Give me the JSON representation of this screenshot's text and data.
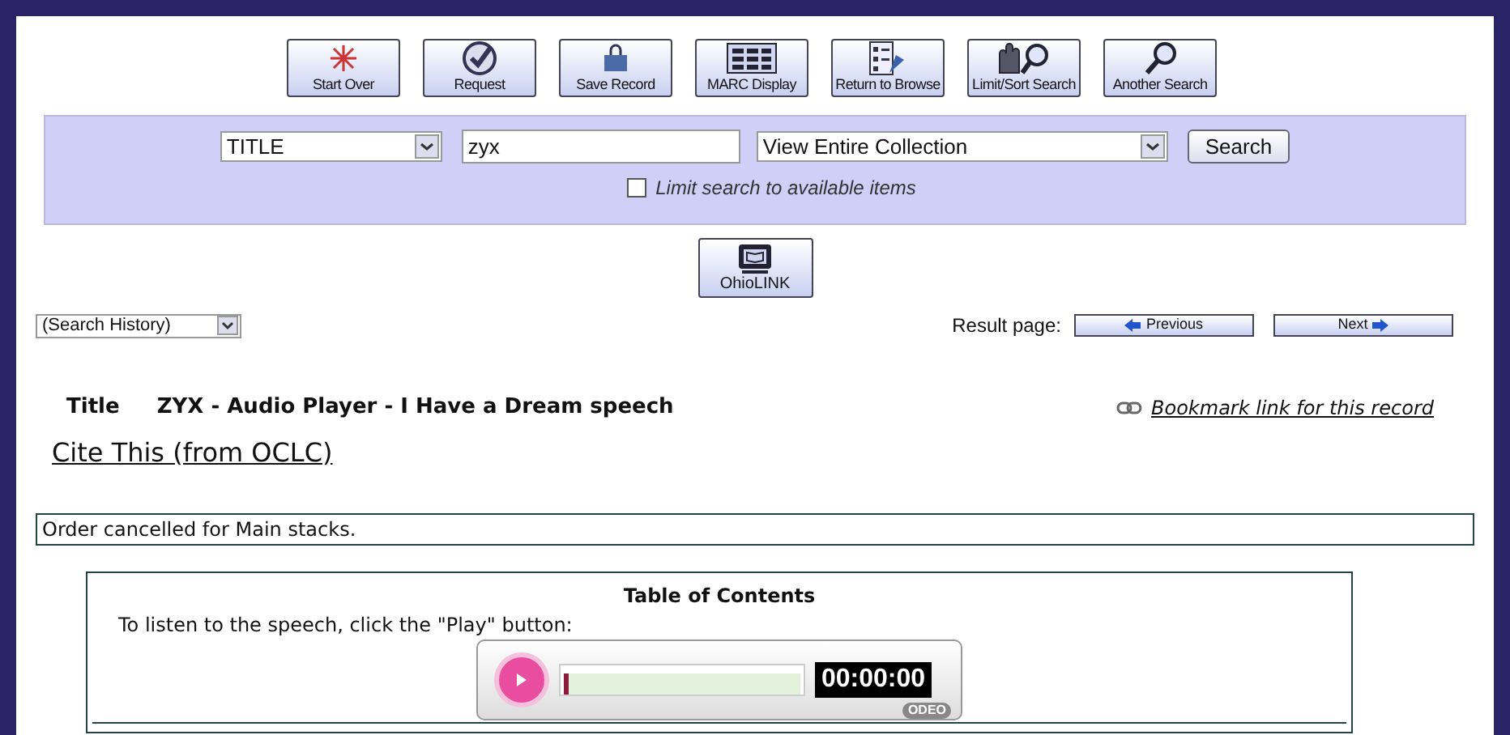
{
  "toolbar_buttons": [
    {
      "label": "Start Over"
    },
    {
      "label": "Request"
    },
    {
      "label": "Save Record"
    },
    {
      "label": "MARC Display"
    },
    {
      "label": "Return to Browse"
    },
    {
      "label": "Limit/Sort Search"
    },
    {
      "label": "Another Search"
    }
  ],
  "search": {
    "field_select": "TITLE",
    "query": "zyx",
    "scope_select": "View Entire Collection",
    "button": "Search",
    "limit_checkbox": {
      "label": "Limit search to available items",
      "checked": false
    }
  },
  "ohiolink_button": "OhioLINK",
  "search_history_select": "(Search History)",
  "result_page": {
    "label": "Result page:",
    "previous": "Previous",
    "next": "Next"
  },
  "record": {
    "title_label": "Title",
    "title": "ZYX - Audio Player - I Have a Dream speech",
    "bookmark_link": "Bookmark link for this record",
    "cite_link": "Cite This (from OCLC)"
  },
  "status_message": "Order cancelled for Main stacks.",
  "toc": {
    "heading": "Table of Contents",
    "instructions": "To listen to the speech, click the \"Play\" button:",
    "player": {
      "time": "00:00:00",
      "level": 0,
      "brand": "ODEO"
    }
  }
}
